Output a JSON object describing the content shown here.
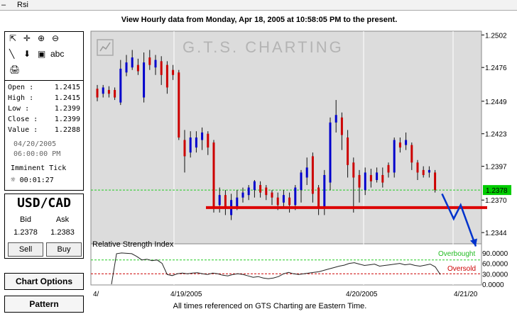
{
  "window": {
    "title": "Rsi",
    "menu_dash": "–"
  },
  "header": {
    "text": "View Hourly  data from Monday, Apr 18, 2005 at 10:58:05 PM to the present."
  },
  "toolbar": {
    "tools": [
      {
        "name": "pointer-icon",
        "glyph": "⇱"
      },
      {
        "name": "crosshair-icon",
        "glyph": "✛"
      },
      {
        "name": "zoom-in-icon",
        "glyph": "⊕"
      },
      {
        "name": "zoom-out-icon",
        "glyph": "⊖"
      },
      {
        "name": "line-tool-icon",
        "glyph": "╲"
      },
      {
        "name": "arrow-down-icon",
        "glyph": "⬇"
      },
      {
        "name": "text-box-icon",
        "glyph": "▣"
      },
      {
        "name": "text-tool-label",
        "glyph": "abc"
      },
      {
        "name": "print-icon",
        "glyph": "🖨"
      }
    ]
  },
  "quote": {
    "open_label": "Open :",
    "open": "1.2415",
    "high_label": "High :",
    "high": "1.2415",
    "low_label": "Low :",
    "low": "1.2399",
    "close_label": "Close :",
    "close": "1.2399",
    "value_label": "Value :",
    "value": "1.2288",
    "date": "04/20/2005",
    "time": "06:00:00 PM",
    "imminent_label": "Imminent Tick",
    "countdown": "00:01:27"
  },
  "pair": {
    "symbol": "USD/CAD",
    "bid_label": "Bid",
    "ask_label": "Ask",
    "bid": "1.2378",
    "ask": "1.2383",
    "sell_label": "Sell",
    "buy_label": "Buy"
  },
  "buttons": {
    "chart_options": "Chart Options",
    "pattern": "Pattern"
  },
  "watermark": "G.T.S. CHARTING",
  "footer": {
    "text": "All times referenced on GTS Charting are Eastern Time."
  },
  "colors": {
    "up": "#0000cc",
    "down": "#cc0000",
    "support": "#dd0000",
    "forecast": "#0033cc",
    "current_price_bg": "#00cc00"
  },
  "chart_data": [
    {
      "type": "candlestick",
      "ylim": [
        1.2335,
        1.2505
      ],
      "y_ticks": [
        "1.2502",
        "1.2476",
        "1.2449",
        "1.2423",
        "1.2397",
        "1.2370",
        "1.2344"
      ],
      "x_ticks": [
        "4/",
        "4/19/2005",
        "4/20/2005",
        "4/21/20"
      ],
      "current_price": "1.2378",
      "support_level": 1.2364,
      "candles": [
        {
          "o": 1.2459,
          "c": 1.2452,
          "h": 1.2462,
          "l": 1.2449
        },
        {
          "o": 1.2455,
          "c": 1.246,
          "h": 1.2462,
          "l": 1.2452
        },
        {
          "o": 1.2458,
          "c": 1.2455,
          "h": 1.2461,
          "l": 1.2452
        },
        {
          "o": 1.2458,
          "c": 1.2452,
          "h": 1.246,
          "l": 1.245
        },
        {
          "o": 1.2448,
          "c": 1.2475,
          "h": 1.2482,
          "l": 1.2446
        },
        {
          "o": 1.2472,
          "c": 1.248,
          "h": 1.2486,
          "l": 1.2469
        },
        {
          "o": 1.2476,
          "c": 1.2484,
          "h": 1.249,
          "l": 1.2474
        },
        {
          "o": 1.2478,
          "c": 1.2473,
          "h": 1.2483,
          "l": 1.247
        },
        {
          "o": 1.2452,
          "c": 1.248,
          "h": 1.2488,
          "l": 1.2448
        },
        {
          "o": 1.2484,
          "c": 1.2478,
          "h": 1.249,
          "l": 1.2474
        },
        {
          "o": 1.2476,
          "c": 1.2482,
          "h": 1.2486,
          "l": 1.247
        },
        {
          "o": 1.2481,
          "c": 1.247,
          "h": 1.2485,
          "l": 1.2462
        },
        {
          "o": 1.2478,
          "c": 1.246,
          "h": 1.2481,
          "l": 1.2455
        },
        {
          "o": 1.2474,
          "c": 1.247,
          "h": 1.2478,
          "l": 1.2466
        },
        {
          "o": 1.2472,
          "c": 1.242,
          "h": 1.2474,
          "l": 1.2418
        },
        {
          "o": 1.2418,
          "c": 1.2405,
          "h": 1.2426,
          "l": 1.2392
        },
        {
          "o": 1.2408,
          "c": 1.242,
          "h": 1.2425,
          "l": 1.2404
        },
        {
          "o": 1.2412,
          "c": 1.242,
          "h": 1.2425,
          "l": 1.2408
        },
        {
          "o": 1.2418,
          "c": 1.2424,
          "h": 1.2428,
          "l": 1.241
        },
        {
          "o": 1.2423,
          "c": 1.2412,
          "h": 1.2425,
          "l": 1.2406
        },
        {
          "o": 1.2416,
          "c": 1.2365,
          "h": 1.2418,
          "l": 1.236
        },
        {
          "o": 1.2366,
          "c": 1.2374,
          "h": 1.238,
          "l": 1.236
        },
        {
          "o": 1.2374,
          "c": 1.2364,
          "h": 1.2378,
          "l": 1.2358
        },
        {
          "o": 1.2358,
          "c": 1.237,
          "h": 1.2375,
          "l": 1.2354
        },
        {
          "o": 1.2365,
          "c": 1.2372,
          "h": 1.2378,
          "l": 1.2362
        },
        {
          "o": 1.2372,
          "c": 1.2376,
          "h": 1.238,
          "l": 1.2368
        },
        {
          "o": 1.2374,
          "c": 1.238,
          "h": 1.2382,
          "l": 1.237
        },
        {
          "o": 1.2378,
          "c": 1.2385,
          "h": 1.2386,
          "l": 1.2372
        },
        {
          "o": 1.2382,
          "c": 1.2376,
          "h": 1.2385,
          "l": 1.2372
        },
        {
          "o": 1.238,
          "c": 1.2374,
          "h": 1.2382,
          "l": 1.237
        },
        {
          "o": 1.2376,
          "c": 1.2372,
          "h": 1.2378,
          "l": 1.2366
        },
        {
          "o": 1.2372,
          "c": 1.2366,
          "h": 1.2376,
          "l": 1.2362
        },
        {
          "o": 1.2368,
          "c": 1.2374,
          "h": 1.2378,
          "l": 1.2364
        },
        {
          "o": 1.2372,
          "c": 1.2366,
          "h": 1.2376,
          "l": 1.236
        },
        {
          "o": 1.2366,
          "c": 1.238,
          "h": 1.2382,
          "l": 1.2362
        },
        {
          "o": 1.2378,
          "c": 1.2392,
          "h": 1.2394,
          "l": 1.2368
        },
        {
          "o": 1.2388,
          "c": 1.2396,
          "h": 1.2404,
          "l": 1.2382
        },
        {
          "o": 1.2405,
          "c": 1.2375,
          "h": 1.2408,
          "l": 1.2368
        },
        {
          "o": 1.238,
          "c": 1.2364,
          "h": 1.2382,
          "l": 1.2358
        },
        {
          "o": 1.2364,
          "c": 1.239,
          "h": 1.2394,
          "l": 1.2358
        },
        {
          "o": 1.2384,
          "c": 1.2432,
          "h": 1.2436,
          "l": 1.2378
        },
        {
          "o": 1.2432,
          "c": 1.2438,
          "h": 1.245,
          "l": 1.2424
        },
        {
          "o": 1.2436,
          "c": 1.2422,
          "h": 1.244,
          "l": 1.241
        },
        {
          "o": 1.242,
          "c": 1.2398,
          "h": 1.2426,
          "l": 1.2388
        },
        {
          "o": 1.24,
          "c": 1.2388,
          "h": 1.2404,
          "l": 1.236
        },
        {
          "o": 1.239,
          "c": 1.238,
          "h": 1.2394,
          "l": 1.2368
        },
        {
          "o": 1.2378,
          "c": 1.2392,
          "h": 1.2396,
          "l": 1.2374
        },
        {
          "o": 1.239,
          "c": 1.2385,
          "h": 1.2395,
          "l": 1.238
        },
        {
          "o": 1.2386,
          "c": 1.2392,
          "h": 1.2396,
          "l": 1.2384
        },
        {
          "o": 1.239,
          "c": 1.2384,
          "h": 1.2396,
          "l": 1.238
        },
        {
          "o": 1.2398,
          "c": 1.2392,
          "h": 1.24,
          "l": 1.2388
        },
        {
          "o": 1.2392,
          "c": 1.2418,
          "h": 1.242,
          "l": 1.2388
        },
        {
          "o": 1.2416,
          "c": 1.2412,
          "h": 1.242,
          "l": 1.2408
        },
        {
          "o": 1.2414,
          "c": 1.2418,
          "h": 1.2424,
          "l": 1.241
        },
        {
          "o": 1.2414,
          "c": 1.24,
          "h": 1.2416,
          "l": 1.2394
        },
        {
          "o": 1.24,
          "c": 1.2392,
          "h": 1.2402,
          "l": 1.2386
        },
        {
          "o": 1.2394,
          "c": 1.239,
          "h": 1.2397,
          "l": 1.2388
        },
        {
          "o": 1.2392,
          "c": 1.2394,
          "h": 1.2397,
          "l": 1.2388
        },
        {
          "o": 1.2392,
          "c": 1.2378,
          "h": 1.2394,
          "l": 1.2376
        }
      ],
      "forecast_path": [
        {
          "i": 59.2,
          "p": 1.2375
        },
        {
          "i": 61.2,
          "p": 1.2355
        },
        {
          "i": 62.4,
          "p": 1.2366
        },
        {
          "i": 65.0,
          "p": 1.2333
        }
      ]
    },
    {
      "type": "line",
      "title": "Relative Strength Index",
      "ylim": [
        0,
        100
      ],
      "y_ticks": [
        "90.0000",
        "60.0000",
        "30.0000",
        "0.0000"
      ],
      "overbought_label": "Overbought",
      "oversold_label": "Oversold",
      "overbought_level": 70,
      "oversold_level": 30,
      "values": [
        0,
        88,
        90,
        89,
        88,
        80,
        70,
        72,
        68,
        70,
        60,
        28,
        25,
        30,
        32,
        30,
        32,
        33,
        30,
        28,
        32,
        30,
        26,
        24,
        28,
        30,
        28,
        24,
        20,
        22,
        18,
        16,
        18,
        22,
        30,
        34,
        30,
        28,
        30,
        32,
        34,
        36,
        40,
        44,
        48,
        52,
        55,
        60,
        62,
        58,
        54,
        56,
        58,
        52,
        54,
        56,
        58,
        60,
        56,
        58,
        54,
        52,
        55,
        58,
        50,
        28
      ]
    }
  ]
}
